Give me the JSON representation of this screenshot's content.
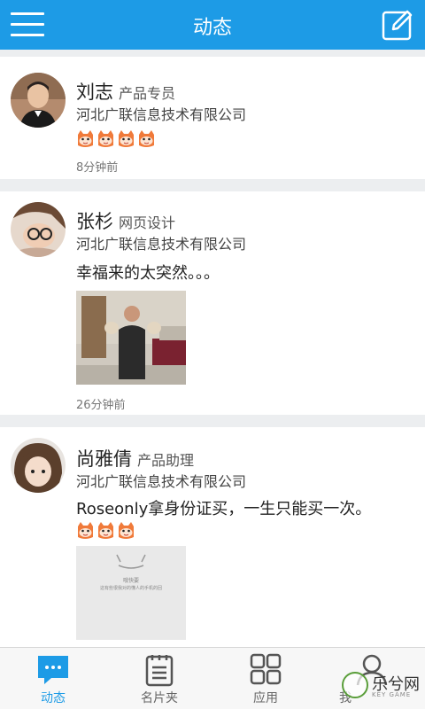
{
  "header": {
    "title": "动态",
    "menu_icon": "hamburger-menu-icon",
    "compose_icon": "compose-edit-icon",
    "bar_color": "#1d9be6"
  },
  "posts": [
    {
      "name": "刘志",
      "role": "产品专员",
      "company": "河北广联信息技术有限公司",
      "content": "",
      "emoji_count": 4,
      "time": "8分钟前"
    },
    {
      "name": "张杉",
      "role": "网页设计",
      "company": "河北广联信息技术有限公司",
      "content": "幸福来的太突然。。。",
      "time": "26分钟前"
    },
    {
      "name": "尚雅倩",
      "role": "产品助理",
      "company": "河北广联信息技术有限公司",
      "content": "Roseonly拿身份证买，一生只能买一次。",
      "emoji_count": 3,
      "image_text_1": "哦快要",
      "image_text_2": "这有些很我对的懂人的手机的回"
    }
  ],
  "tabs": [
    {
      "label": "动态",
      "icon": "chat-bubble-icon",
      "active": true
    },
    {
      "label": "名片夹",
      "icon": "notepad-icon",
      "active": false
    },
    {
      "label": "应用",
      "icon": "apps-grid-icon",
      "active": false
    },
    {
      "label": "我",
      "icon": "person-icon",
      "active": false
    }
  ],
  "watermark": {
    "text": "乐兮网",
    "sub": "KEY GAME"
  }
}
